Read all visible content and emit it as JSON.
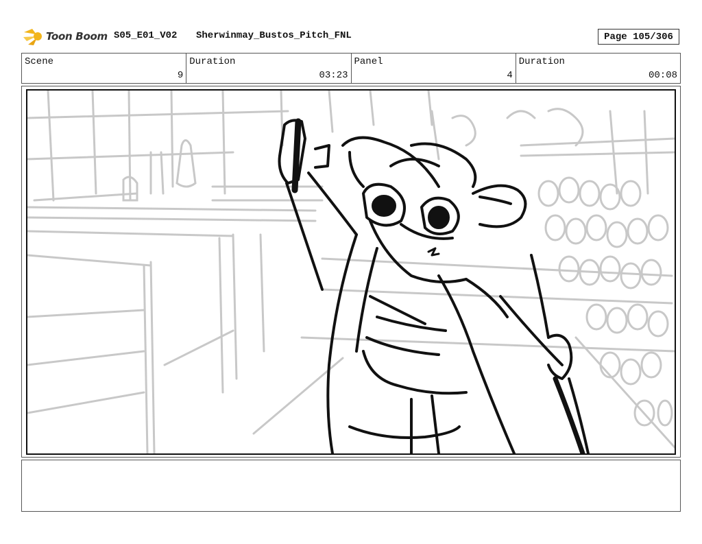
{
  "header": {
    "logo_text": "Toon Boom",
    "project_code": "S05_E01_V02",
    "project_name": "Sherwinmay_Bustos_Pitch_FNL",
    "page_label": "Page 105/306"
  },
  "info": {
    "scene_label": "Scene",
    "scene_value": "9",
    "duration_label": "Duration",
    "duration_value": "03:23",
    "panel_label": "Panel",
    "panel_value": "4",
    "panel_duration_label": "Duration",
    "panel_duration_value": "00:08"
  },
  "panel": {
    "sketch_icon": "storyboard-sketch",
    "colors": {
      "background_lines": "#c8c8c8",
      "character_lines": "#111111"
    }
  },
  "notes": {
    "text": ""
  },
  "colors": {
    "logo_accent": "#f2b51c",
    "border": "#555555"
  }
}
